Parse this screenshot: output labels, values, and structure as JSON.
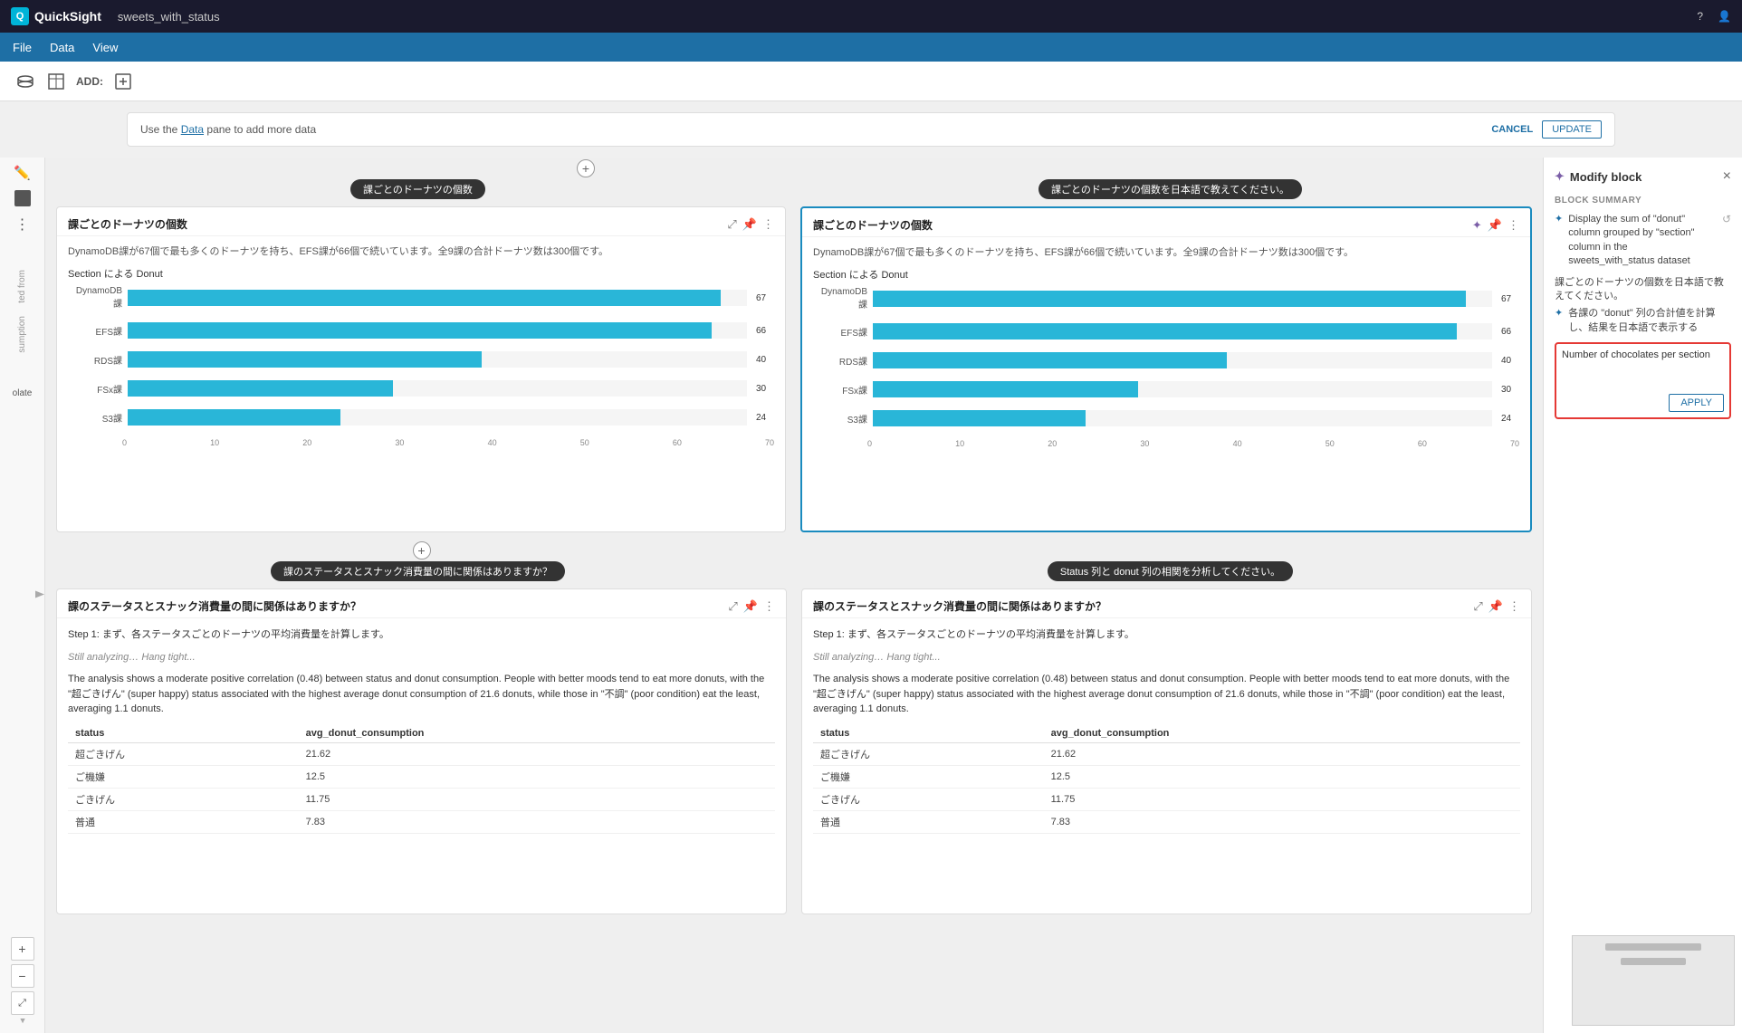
{
  "topbar": {
    "logo": "Q",
    "app_name": "QuickSight",
    "tab_title": "sweets_with_status",
    "help_icon": "?",
    "user_icon": "👤"
  },
  "menubar": {
    "items": [
      "File",
      "Data",
      "View"
    ]
  },
  "toolbar": {
    "add_label": "ADD:"
  },
  "notification": {
    "text": "Use the ",
    "link_text": "Data",
    "text2": " pane to add more data",
    "cancel_label": "CANCEL",
    "update_label": "UPDATE"
  },
  "sections": [
    {
      "label": "課ごとのドーナツの個数",
      "add_icon": "+"
    },
    {
      "label": "課のステータスとスナック消費量の間に関係はありますか？",
      "add_icon": "+"
    }
  ],
  "sections_right": [
    {
      "label": "課ごとのドーナツの個数を日本語で教えてください。"
    },
    {
      "label": "Status 列と donut 列の相関を分析してください。"
    }
  ],
  "panels": [
    {
      "id": "panel1",
      "title": "課ごとのドーナツの個数",
      "description": "DynamoDB課が67個で最も多くのドーナツを持ち、EFS課が66個で続いています。全9課の合計ドーナツ数は300個です。",
      "chart_title": "Section による Donut",
      "bars": [
        {
          "label": "DynamoDB課",
          "value": 67,
          "max": 70
        },
        {
          "label": "EFS課",
          "value": 66,
          "max": 70
        },
        {
          "label": "RDS課",
          "value": 40,
          "max": 70
        },
        {
          "label": "FSx課",
          "value": 30,
          "max": 70
        },
        {
          "label": "S3課",
          "value": 24,
          "max": 70
        }
      ],
      "axis_labels": [
        "0",
        "10",
        "20",
        "30",
        "40",
        "50",
        "60",
        "70"
      ],
      "selected": false
    },
    {
      "id": "panel2",
      "title": "課ごとのドーナツの個数",
      "description": "DynamoDB課が67個で最も多くのドーナツを持ち、EFS課が66個で続いています。全9課の合計ドーナツ数は300個です。",
      "chart_title": "Section による Donut",
      "bars": [
        {
          "label": "DynamoDB課",
          "value": 67,
          "max": 70
        },
        {
          "label": "EFS課",
          "value": 66,
          "max": 70
        },
        {
          "label": "RDS課",
          "value": 40,
          "max": 70
        },
        {
          "label": "FSx課",
          "value": 30,
          "max": 70
        },
        {
          "label": "S3課",
          "value": 24,
          "max": 70
        }
      ],
      "axis_labels": [
        "0",
        "10",
        "20",
        "30",
        "40",
        "50",
        "60",
        "70"
      ],
      "selected": true
    }
  ],
  "bottom_panels": [
    {
      "id": "panel3",
      "title": "課のステータスとスナック消費量の間に関係はありますか？",
      "step1": "Step 1: まず、各ステータスごとのドーナツの平均消費量を計算します。",
      "analyzing": "Still analyzing… Hang tight...",
      "analysis": "The analysis shows a moderate positive correlation (0.48) between status and donut consumption. People with better moods tend to eat more donuts, with the \"超ごきげん\" (super happy) status associated with the highest average donut consumption of 21.6 donuts, while those in \"不調\" (poor condition) eat the least, averaging 1.1 donuts.",
      "table_headers": [
        "status",
        "avg_donut_consumption"
      ],
      "table_rows": [
        [
          "超ごきげん",
          "21.62"
        ],
        [
          "ご機嫌",
          "12.5"
        ],
        [
          "ごきげん",
          "11.75"
        ],
        [
          "普通",
          "7.83"
        ]
      ]
    },
    {
      "id": "panel4",
      "title": "課のステータスとスナック消費量の間に関係はありますか？",
      "step1": "Step 1: まず、各ステータスごとのドーナツの平均消費量を計算します。",
      "analyzing": "Still analyzing… Hang tight...",
      "analysis": "The analysis shows a moderate positive correlation (0.48) between status and donut consumption. People with better moods tend to eat more donuts, with the \"超ごきげん\" (super happy) status associated with the highest average donut consumption of 21.6 donuts, while those in \"不調\" (poor condition) eat the least, averaging 1.1 donuts.",
      "table_headers": [
        "status",
        "avg_donut_consumption"
      ],
      "table_rows": [
        [
          "超ごきげん",
          "21.62"
        ],
        [
          "ご機嫌",
          "12.5"
        ],
        [
          "ごきげん",
          "11.75"
        ],
        [
          "普通",
          "7.83"
        ]
      ]
    }
  ],
  "modify_block": {
    "title": "Modify block",
    "close_icon": "×",
    "block_summary_label": "Block summary",
    "summary_items": [
      "Display the sum of \"donut\" column grouped by \"section\" column in the sweets_with_status dataset"
    ],
    "jp_prompt": "課ごとのドーナツの個数を日本語で教えてください。",
    "jp_instruction": "各課の \"donut\" 列の合計値を計算し、結果を日本語で表示する",
    "input_placeholder": "Number of chocolates per section",
    "apply_label": "APPLY"
  },
  "left_panel": {
    "label_items": [
      "ted from",
      "sumption"
    ],
    "section_label": "olate"
  },
  "scroll_controls": {
    "zoom_in": "+",
    "zoom_out": "−",
    "expand": "⤢"
  }
}
